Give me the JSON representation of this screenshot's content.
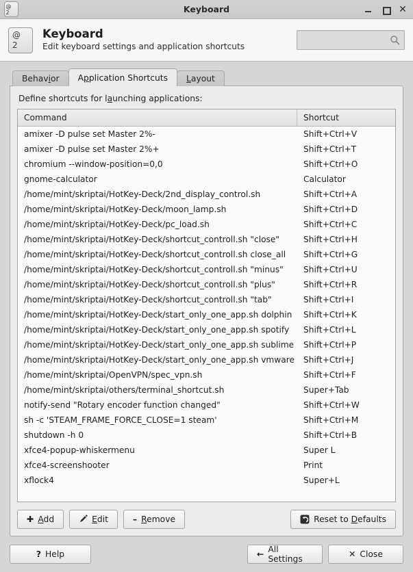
{
  "window": {
    "title": "Keyboard",
    "icon": "keyboard-key-icon",
    "keycap_top": "@",
    "keycap_bottom": "2",
    "controls": {
      "minimize": "minimize-icon",
      "maximize": "maximize-icon",
      "close": "✕"
    }
  },
  "header": {
    "title": "Keyboard",
    "subtitle": "Edit keyboard settings and application shortcuts",
    "icon": "keyboard-key-icon",
    "keycap_top": "@",
    "keycap_bottom": "2"
  },
  "search": {
    "value": "",
    "placeholder": "",
    "icon": "search-icon"
  },
  "tabs": [
    {
      "label": "Behavior",
      "mnemonic_index": 5,
      "active": false
    },
    {
      "label": "Application Shortcuts",
      "mnemonic_index": 1,
      "active": true
    },
    {
      "label": "Layout",
      "mnemonic_index": 0,
      "active": false
    }
  ],
  "panel": {
    "label": "Define shortcuts for launching applications:",
    "label_mnemonic_index": 22
  },
  "table": {
    "columns": [
      "Command",
      "Shortcut"
    ],
    "rows": [
      [
        "amixer -D pulse set Master 2%-",
        "Shift+Ctrl+V"
      ],
      [
        "amixer -D pulse set Master 2%+",
        "Shift+Ctrl+T"
      ],
      [
        "chromium --window-position=0,0",
        "Shift+Ctrl+O"
      ],
      [
        "gnome-calculator",
        "Calculator"
      ],
      [
        "/home/mint/skriptai/HotKey-Deck/2nd_display_control.sh",
        "Shift+Ctrl+A"
      ],
      [
        "/home/mint/skriptai/HotKey-Deck/moon_lamp.sh",
        "Shift+Ctrl+D"
      ],
      [
        "/home/mint/skriptai/HotKey-Deck/pc_load.sh",
        "Shift+Ctrl+C"
      ],
      [
        "/home/mint/skriptai/HotKey-Deck/shortcut_controll.sh \"close\"",
        "Shift+Ctrl+H"
      ],
      [
        "/home/mint/skriptai/HotKey-Deck/shortcut_controll.sh close_all",
        "Shift+Ctrl+G"
      ],
      [
        "/home/mint/skriptai/HotKey-Deck/shortcut_controll.sh \"minus\"",
        "Shift+Ctrl+U"
      ],
      [
        "/home/mint/skriptai/HotKey-Deck/shortcut_controll.sh \"plus\"",
        "Shift+Ctrl+R"
      ],
      [
        "/home/mint/skriptai/HotKey-Deck/shortcut_controll.sh \"tab\"",
        "Shift+Ctrl+I"
      ],
      [
        "/home/mint/skriptai/HotKey-Deck/start_only_one_app.sh dolphin",
        "Shift+Ctrl+K"
      ],
      [
        "/home/mint/skriptai/HotKey-Deck/start_only_one_app.sh spotify",
        "Shift+Ctrl+L"
      ],
      [
        "/home/mint/skriptai/HotKey-Deck/start_only_one_app.sh sublime",
        "Shift+Ctrl+P"
      ],
      [
        "/home/mint/skriptai/HotKey-Deck/start_only_one_app.sh vmware",
        "Shift+Ctrl+J"
      ],
      [
        "/home/mint/skriptai/OpenVPN/spec_vpn.sh",
        "Shift+Ctrl+F"
      ],
      [
        "/home/mint/skriptai/others/terminal_shortcut.sh",
        "Super+Tab"
      ],
      [
        "notify-send \"Rotary encoder function changed\"",
        "Shift+Ctrl+W"
      ],
      [
        "sh -c 'STEAM_FRAME_FORCE_CLOSE=1 steam'",
        "Shift+Ctrl+M"
      ],
      [
        "shutdown -h 0",
        "Shift+Ctrl+B"
      ],
      [
        "xfce4-popup-whiskermenu",
        "Super L"
      ],
      [
        "xfce4-screenshooter",
        "Print"
      ],
      [
        "xflock4",
        "Super+L"
      ]
    ]
  },
  "actions": {
    "add": {
      "label": "Add",
      "mnemonic_index": 0,
      "icon": "plus-icon"
    },
    "edit": {
      "label": "Edit",
      "mnemonic_index": 0,
      "icon": "pencil-icon"
    },
    "remove": {
      "label": "Remove",
      "mnemonic_index": 0,
      "icon": "minus-icon"
    },
    "reset": {
      "label": "Reset to Defaults",
      "mnemonic_index": 9,
      "icon": "revert-icon"
    }
  },
  "bottom": {
    "help": {
      "label": "Help",
      "icon": "question-icon"
    },
    "all_settings": {
      "label": "All Settings",
      "icon": "arrow-left-icon"
    },
    "close": {
      "label": "Close",
      "icon": "close-x-icon"
    }
  },
  "colors": {
    "window_bg": "#d6d6d4",
    "panel_bg": "#ececea",
    "list_bg": "#fbfbfa",
    "header_bg": "#f6f6f4",
    "border": "#a9a9a7",
    "text": "#1f1f1d"
  }
}
